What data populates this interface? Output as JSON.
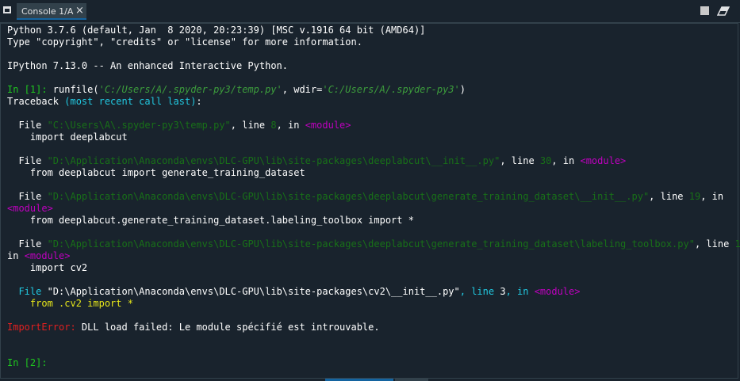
{
  "tab": {
    "title": "Console 1/A",
    "close": "×"
  },
  "colors": {
    "background": "#19232d",
    "prompt_green": "#1fc71f",
    "error_red": "#e02020",
    "module_magenta": "#c000c0",
    "accent_blue": "#1464a0"
  },
  "icons": {
    "window": "window-icon",
    "stop": "stop-kernel-icon",
    "clear": "eraser-icon"
  },
  "console": {
    "lines": [
      [
        {
          "t": "Python 3.7.6 (default, Jan  8 2020, 20:23:39) [MSC v.1916 64 bit (AMD64)]",
          "c": "w"
        }
      ],
      [
        {
          "t": "Type \"copyright\", \"credits\" or \"license\" for more information.",
          "c": "w"
        }
      ],
      [],
      [
        {
          "t": "IPython 7.13.0 -- An enhanced Interactive Python.",
          "c": "w"
        }
      ],
      [],
      [
        {
          "t": "In [1]: ",
          "c": "g"
        },
        {
          "t": "runfile(",
          "c": "w"
        },
        {
          "t": "'C:/Users/A/.spyder-py3/temp.py'",
          "c": "g2 it"
        },
        {
          "t": ", wdir=",
          "c": "w"
        },
        {
          "t": "'C:/Users/A/.spyder-py3'",
          "c": "g2 it"
        },
        {
          "t": ")",
          "c": "w"
        }
      ],
      [
        {
          "t": "Traceback ",
          "c": "w"
        },
        {
          "t": "(most recent call last)",
          "c": "cy"
        },
        {
          "t": ":",
          "c": "w"
        }
      ],
      [],
      [
        {
          "t": "  File ",
          "c": "w"
        },
        {
          "t": "\"C:\\Users\\A\\.spyder-py3\\temp.py\"",
          "c": "dg"
        },
        {
          "t": ", line ",
          "c": "w"
        },
        {
          "t": "8",
          "c": "dg"
        },
        {
          "t": ", in ",
          "c": "w"
        },
        {
          "t": "<module>",
          "c": "ma"
        }
      ],
      [
        {
          "t": "    import deeplabcut",
          "c": "w"
        }
      ],
      [],
      [
        {
          "t": "  File ",
          "c": "w"
        },
        {
          "t": "\"D:\\Application\\Anaconda\\envs\\DLC-GPU\\lib\\site-packages\\deeplabcut\\__init__.py\"",
          "c": "dg"
        },
        {
          "t": ", line ",
          "c": "w"
        },
        {
          "t": "30",
          "c": "dg"
        },
        {
          "t": ", in ",
          "c": "w"
        },
        {
          "t": "<module>",
          "c": "ma"
        }
      ],
      [
        {
          "t": "    from deeplabcut import generate_training_dataset",
          "c": "w"
        }
      ],
      [],
      [
        {
          "t": "  File ",
          "c": "w"
        },
        {
          "t": "\"D:\\Application\\Anaconda\\envs\\DLC-GPU\\lib\\site-packages\\deeplabcut\\generate_training_dataset\\__init__.py\"",
          "c": "dg"
        },
        {
          "t": ", line ",
          "c": "w"
        },
        {
          "t": "19",
          "c": "dg"
        },
        {
          "t": ", in",
          "c": "w"
        }
      ],
      [
        {
          "t": "<module>",
          "c": "ma"
        }
      ],
      [
        {
          "t": "    from deeplabcut.generate_training_dataset.labeling_toolbox import *",
          "c": "w"
        }
      ],
      [],
      [
        {
          "t": "  File ",
          "c": "w"
        },
        {
          "t": "\"D:\\Application\\Anaconda\\envs\\DLC-GPU\\lib\\site-packages\\deeplabcut\\generate_training_dataset\\labeling_toolbox.py\"",
          "c": "dg"
        },
        {
          "t": ", line ",
          "c": "w"
        },
        {
          "t": "14",
          "c": "dg"
        },
        {
          "t": ",",
          "c": "w"
        }
      ],
      [
        {
          "t": "in ",
          "c": "w"
        },
        {
          "t": "<module>",
          "c": "ma"
        }
      ],
      [
        {
          "t": "    import cv2",
          "c": "w"
        }
      ],
      [],
      [
        {
          "t": "  File ",
          "c": "cy"
        },
        {
          "t": "\"D:\\Application\\Anaconda\\envs\\DLC-GPU\\lib\\site-packages\\cv2\\__init__.py\"",
          "c": "w"
        },
        {
          "t": ", line ",
          "c": "cy"
        },
        {
          "t": "3",
          "c": "w"
        },
        {
          "t": ", in ",
          "c": "cy"
        },
        {
          "t": "<module>",
          "c": "ma"
        }
      ],
      [
        {
          "t": "    from .cv2 import *",
          "c": "ye"
        }
      ],
      [],
      [
        {
          "t": "ImportError:",
          "c": "re"
        },
        {
          "t": " DLL load failed: Le module spécifié est introuvable.",
          "c": "w"
        }
      ],
      [],
      [],
      [
        {
          "t": "In [2]: ",
          "c": "g"
        }
      ]
    ]
  }
}
